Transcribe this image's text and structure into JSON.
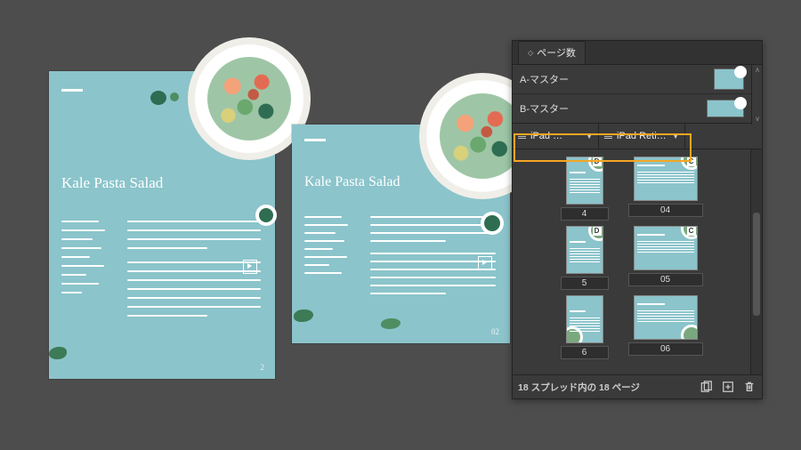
{
  "panel": {
    "tab_label": "ページ数",
    "masters": [
      {
        "label": "A-マスター"
      },
      {
        "label": "B-マスター"
      }
    ],
    "layouts": [
      {
        "label": "iPad …"
      },
      {
        "label": "iPad Retin…"
      }
    ],
    "pages_left": [
      {
        "letter": "D",
        "num": "4"
      },
      {
        "letter": "D",
        "num": "5"
      },
      {
        "letter": "",
        "num": "6"
      }
    ],
    "pages_right": [
      {
        "letter": "C",
        "num": "04"
      },
      {
        "letter": "C",
        "num": "05"
      },
      {
        "letter": "",
        "num": "06"
      }
    ],
    "status": "18 スプレッド内の 18 ページ"
  },
  "doc": {
    "title": "Kale Pasta Salad",
    "page_a": "2",
    "page_b": "02"
  },
  "icons": {
    "layout_opts": "layout-options-icon",
    "new_page": "new-page-icon",
    "trash": "trash-icon"
  }
}
